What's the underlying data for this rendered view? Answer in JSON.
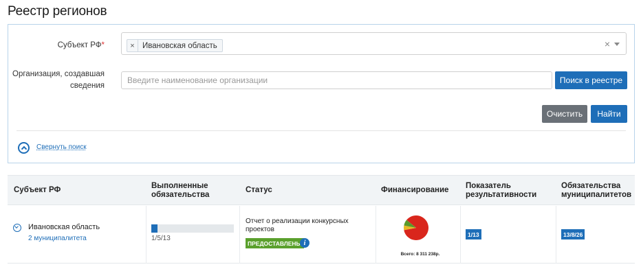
{
  "page": {
    "title": "Реестр регионов"
  },
  "search": {
    "subject_label": "Субъект РФ",
    "required_mark": "*",
    "selected_tag_remove": "×",
    "selected_tag": "Ивановская область",
    "clear_selection": "×",
    "org_label_line1": "Организация, создавшая",
    "org_label_line2": "сведения",
    "org_placeholder": "Введите наименование организации",
    "org_value": "",
    "search_registry_button": "Поиск в реестре",
    "clear_button": "Очистить",
    "find_button": "Найти",
    "collapse_link": "Свернуть поиск"
  },
  "table": {
    "headers": {
      "subject": "Субъект РФ",
      "obligations_line1": "Выполненные",
      "obligations_line2": "обязательства",
      "status": "Статус",
      "financing": "Финансирование",
      "indicator_line1": "Показатель",
      "indicator_line2": "результативности",
      "municipal_line1": "Обязательства",
      "municipal_line2": "муниципалитетов"
    },
    "rows": [
      {
        "region": "Ивановская область",
        "municipalities_link": "2 муниципалитета",
        "obligations_text": "1/5/13",
        "obligations_progress": 0.077,
        "status_text": "Отчет о реализации конкурсных проектов",
        "status_badge": "ПРЕДОСТАВЛЕНЫ",
        "financing_total": "Всего: 8 311 238р.",
        "financing_slices": [
          {
            "value": 0.86,
            "color": "#d9261c"
          },
          {
            "value": 0.06,
            "color": "#e8b925"
          },
          {
            "value": 0.08,
            "color": "#5a9a2a"
          }
        ],
        "indicator": "1/13",
        "municipal_obligations": "13/8/26"
      }
    ]
  },
  "colors": {
    "accent": "#1e6eb8",
    "status_ok": "#5aa02c",
    "button_gray": "#6a7077"
  },
  "icons": {
    "collapse": "chevron-up-circle-icon",
    "row_toggle": "chevron-down-circle-icon",
    "info": "info-icon"
  }
}
